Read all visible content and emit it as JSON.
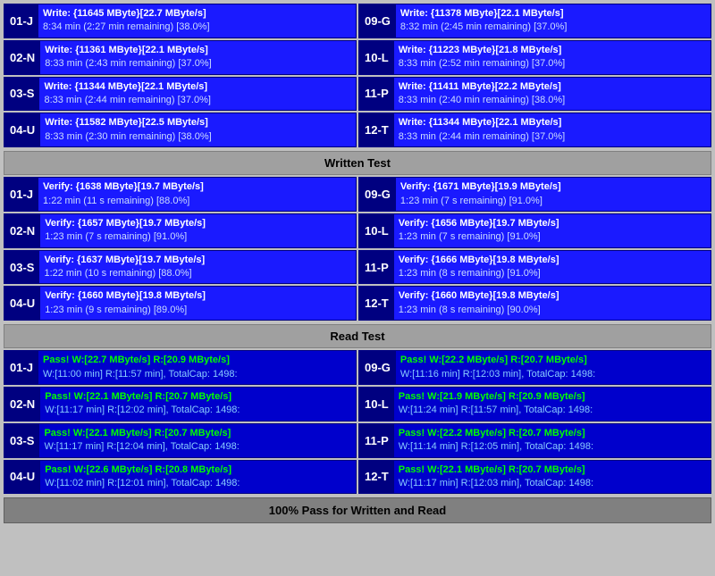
{
  "sections": {
    "written_test": {
      "label": "Written Test",
      "write_devices": [
        {
          "id": "01-J",
          "line1": "Write: {11645 MByte}[22.7 MByte/s]",
          "line2": "8:34 min (2:27 min remaining)  [38.0%]"
        },
        {
          "id": "09-G",
          "line1": "Write: {11378 MByte}[22.1 MByte/s]",
          "line2": "8:32 min (2:45 min remaining)  [37.0%]"
        },
        {
          "id": "02-N",
          "line1": "Write: {11361 MByte}[22.1 MByte/s]",
          "line2": "8:33 min (2:43 min remaining)  [37.0%]"
        },
        {
          "id": "10-L",
          "line1": "Write: {11223 MByte}[21.8 MByte/s]",
          "line2": "8:33 min (2:52 min remaining)  [37.0%]"
        },
        {
          "id": "03-S",
          "line1": "Write: {11344 MByte}[22.1 MByte/s]",
          "line2": "8:33 min (2:44 min remaining)  [37.0%]"
        },
        {
          "id": "11-P",
          "line1": "Write: {11411 MByte}[22.2 MByte/s]",
          "line2": "8:33 min (2:40 min remaining)  [38.0%]"
        },
        {
          "id": "04-U",
          "line1": "Write: {11582 MByte}[22.5 MByte/s]",
          "line2": "8:33 min (2:30 min remaining)  [38.0%]"
        },
        {
          "id": "12-T",
          "line1": "Write: {11344 MByte}[22.1 MByte/s]",
          "line2": "8:33 min (2:44 min remaining)  [37.0%]"
        }
      ],
      "verify_devices": [
        {
          "id": "01-J",
          "line1": "Verify: {1638 MByte}[19.7 MByte/s]",
          "line2": "1:22 min (11 s remaining)  [88.0%]"
        },
        {
          "id": "09-G",
          "line1": "Verify: {1671 MByte}[19.9 MByte/s]",
          "line2": "1:23 min (7 s remaining)  [91.0%]"
        },
        {
          "id": "02-N",
          "line1": "Verify: {1657 MByte}[19.7 MByte/s]",
          "line2": "1:23 min (7 s remaining)  [91.0%]"
        },
        {
          "id": "10-L",
          "line1": "Verify: {1656 MByte}[19.7 MByte/s]",
          "line2": "1:23 min (7 s remaining)  [91.0%]"
        },
        {
          "id": "03-S",
          "line1": "Verify: {1637 MByte}[19.7 MByte/s]",
          "line2": "1:22 min (10 s remaining)  [88.0%]"
        },
        {
          "id": "11-P",
          "line1": "Verify: {1666 MByte}[19.8 MByte/s]",
          "line2": "1:23 min (8 s remaining)  [91.0%]"
        },
        {
          "id": "04-U",
          "line1": "Verify: {1660 MByte}[19.8 MByte/s]",
          "line2": "1:23 min (9 s remaining)  [89.0%]"
        },
        {
          "id": "12-T",
          "line1": "Verify: {1660 MByte}[19.8 MByte/s]",
          "line2": "1:23 min (8 s remaining)  [90.0%]"
        }
      ]
    },
    "read_test": {
      "label": "Read Test",
      "pass_devices": [
        {
          "id": "01-J",
          "line1": "Pass! W:[22.7 MByte/s] R:[20.9 MByte/s]",
          "line2": "W:[11:00 min] R:[11:57 min], TotalCap: 1498:"
        },
        {
          "id": "09-G",
          "line1": "Pass! W:[22.2 MByte/s] R:[20.7 MByte/s]",
          "line2": "W:[11:16 min] R:[12:03 min], TotalCap: 1498:"
        },
        {
          "id": "02-N",
          "line1": "Pass! W:[22.1 MByte/s] R:[20.7 MByte/s]",
          "line2": "W:[11:17 min] R:[12:02 min], TotalCap: 1498:"
        },
        {
          "id": "10-L",
          "line1": "Pass! W:[21.9 MByte/s] R:[20.9 MByte/s]",
          "line2": "W:[11:24 min] R:[11:57 min], TotalCap: 1498:"
        },
        {
          "id": "03-S",
          "line1": "Pass! W:[22.1 MByte/s] R:[20.7 MByte/s]",
          "line2": "W:[11:17 min] R:[12:04 min], TotalCap: 1498:"
        },
        {
          "id": "11-P",
          "line1": "Pass! W:[22.2 MByte/s] R:[20.7 MByte/s]",
          "line2": "W:[11:14 min] R:[12:05 min], TotalCap: 1498:"
        },
        {
          "id": "04-U",
          "line1": "Pass! W:[22.6 MByte/s] R:[20.8 MByte/s]",
          "line2": "W:[11:02 min] R:[12:01 min], TotalCap: 1498:"
        },
        {
          "id": "12-T",
          "line1": "Pass! W:[22.1 MByte/s] R:[20.7 MByte/s]",
          "line2": "W:[11:17 min] R:[12:03 min], TotalCap: 1498:"
        }
      ]
    }
  },
  "footer": {
    "label": "100% Pass for Written and Read"
  },
  "headers": {
    "written": "Written Test",
    "read": "Read Test"
  }
}
